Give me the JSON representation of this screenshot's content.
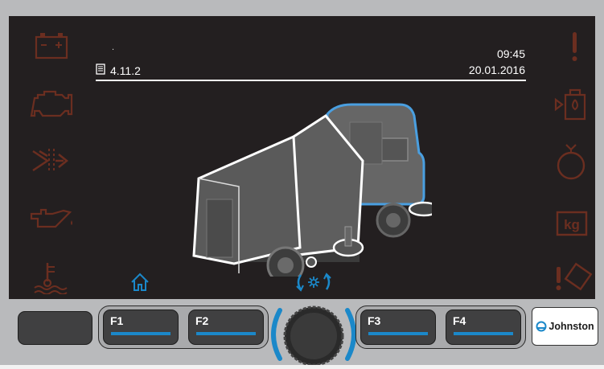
{
  "header": {
    "marker": ".",
    "version": "4.11.2",
    "time": "09:45",
    "date": "20.01.2016"
  },
  "left_icons": [
    "battery-warning-icon",
    "engine-warning-icon",
    "transmission-flow-icon",
    "oil-pressure-icon",
    "coolant-temperature-icon"
  ],
  "right_icons": [
    "general-warning-icon",
    "water-tank-icon",
    "suction-fan-icon",
    "weight-kg-icon",
    "tilt-warning-icon"
  ],
  "bottom_nav": [
    "home-icon",
    "fan-mode-icon"
  ],
  "softkeys": {
    "f1": "F1",
    "f2": "F2",
    "f3": "F3",
    "f4": "F4"
  },
  "brand": {
    "logo_text": "Johnston"
  },
  "colors": {
    "warning_icon": "#6b2e20",
    "accent": "#1b88c9",
    "screen_bg": "#231f20"
  }
}
